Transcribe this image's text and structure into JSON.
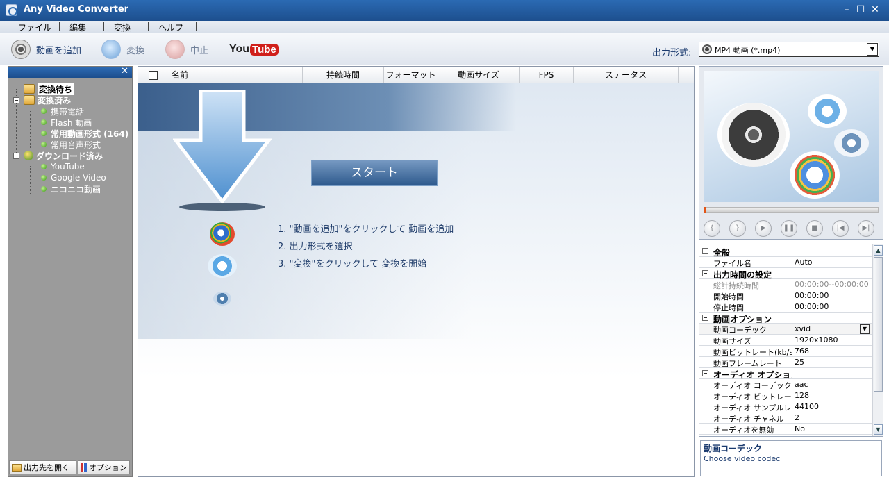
{
  "window": {
    "title": "Any Video Converter"
  },
  "menu": [
    "ファイル",
    "編集",
    "変換",
    "ヘルプ"
  ],
  "toolbar": {
    "add_video": "動画を追加",
    "convert": "変換",
    "stop": "中止",
    "youtube_you": "You",
    "youtube_tube": "Tube",
    "output_format_label": "出力形式:",
    "output_format_value": "MP4 動画 (*.mp4)"
  },
  "tree": [
    {
      "label": "変換待ち",
      "level": 0,
      "bold": true,
      "selected": true
    },
    {
      "label": "変換済み",
      "level": 0,
      "bold": true
    },
    {
      "label": "携帯電話",
      "level": 1
    },
    {
      "label": "Flash 動画",
      "level": 1
    },
    {
      "label": "常用動画形式 (164)",
      "level": 1,
      "bold": true
    },
    {
      "label": "常用音声形式",
      "level": 1
    },
    {
      "label": "ダウンロード済み",
      "level": 0,
      "bold": true
    },
    {
      "label": "YouTube",
      "level": 1
    },
    {
      "label": "Google Video",
      "level": 1
    },
    {
      "label": "ニコニコ動画",
      "level": 1
    }
  ],
  "left_footer": {
    "open_output": "出力先を開く",
    "options": "オプション"
  },
  "columns": [
    "名前",
    "持続時間",
    "フォーマット",
    "動画サイズ",
    "FPS",
    "ステータス"
  ],
  "start": {
    "button": "スタート",
    "steps": [
      "1. \"動画を追加\"をクリックして 動画を追加",
      "2. 出力形式を選択",
      "3. \"変換\"をクリックして 変換を開始"
    ]
  },
  "player": {
    "progress_fraction": 0.0
  },
  "properties": [
    {
      "type": "cat",
      "label": "全般"
    },
    {
      "type": "row",
      "k": "ファイル名",
      "v": "Auto"
    },
    {
      "type": "cat",
      "label": "出力時間の設定"
    },
    {
      "type": "row",
      "k": "総計持続時間",
      "v": "00:00:00--00:00:00",
      "gray": true
    },
    {
      "type": "row",
      "k": "開始時間",
      "v": "00:00:00"
    },
    {
      "type": "row",
      "k": "停止時間",
      "v": "00:00:00"
    },
    {
      "type": "cat",
      "label": "動画オプション"
    },
    {
      "type": "row",
      "k": "動画コーデック",
      "v": "xvid",
      "highlight": true,
      "dropdown": true
    },
    {
      "type": "row",
      "k": "動画サイズ",
      "v": "1920x1080"
    },
    {
      "type": "row",
      "k": "動画ビットレート(kb/s)",
      "v": "768"
    },
    {
      "type": "row",
      "k": "動画フレームレート",
      "v": "25"
    },
    {
      "type": "cat",
      "label": "オーディオ オプション"
    },
    {
      "type": "row",
      "k": "オーディオ コーデック",
      "v": "aac"
    },
    {
      "type": "row",
      "k": "オーディオ ビットレート...",
      "v": "128"
    },
    {
      "type": "row",
      "k": "オーディオ サンプルレ...",
      "v": "44100"
    },
    {
      "type": "row",
      "k": "オーディオ チャネル",
      "v": "2"
    },
    {
      "type": "row",
      "k": "オーディオを無効",
      "v": "No"
    }
  ],
  "description": {
    "title": "動画コーデック",
    "text": "Choose video codec"
  }
}
